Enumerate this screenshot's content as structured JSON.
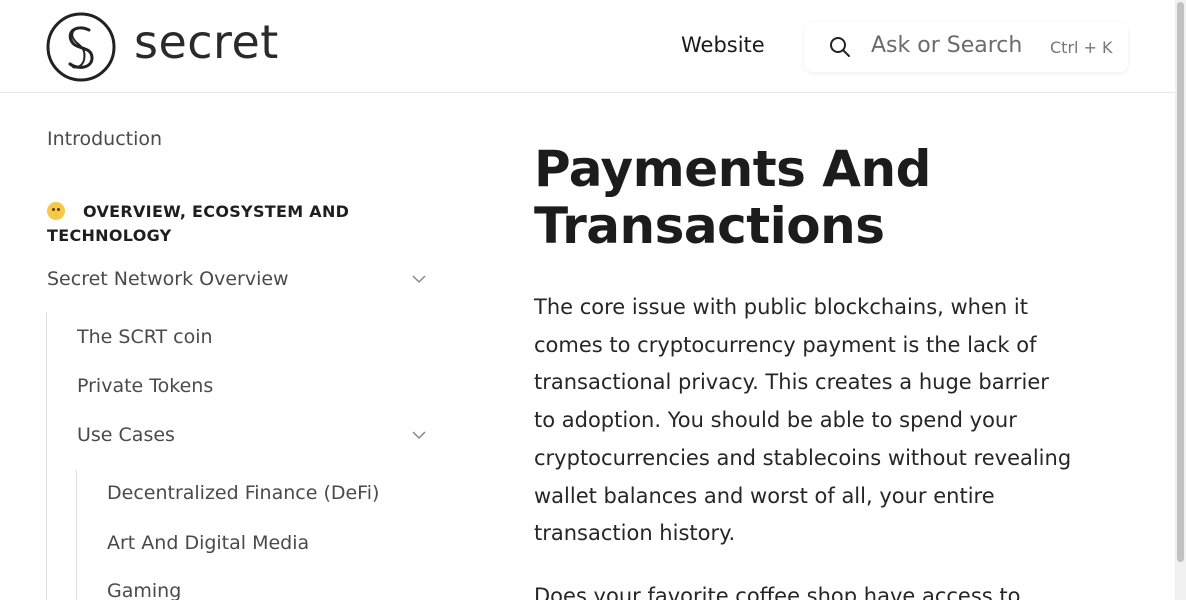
{
  "header": {
    "logo_text": "secret",
    "nav_link": "Website",
    "search": {
      "placeholder": "Ask or Search",
      "shortcut": "Ctrl + K"
    }
  },
  "sidebar": {
    "intro": "Introduction",
    "section_title": "OVERVIEW, ECOSYSTEM AND TECHNOLOGY",
    "section_icon": "shushing-face-emoji",
    "items": [
      {
        "label": "Secret Network Overview",
        "expandable": true
      },
      {
        "label": "The SCRT coin"
      },
      {
        "label": "Private Tokens"
      },
      {
        "label": "Use Cases",
        "expandable": true
      },
      {
        "label": "Decentralized Finance (DeFi)"
      },
      {
        "label": "Art And Digital Media"
      },
      {
        "label": "Gaming"
      }
    ]
  },
  "main": {
    "title": "Payments And Transactions",
    "paragraphs": [
      "The core issue with public blockchains, when it comes to cryptocurrency payment is the lack of transactional privacy. This creates a huge barrier to adoption. You should be able to spend your cryptocurrencies and stablecoins without revealing wallet balances and worst of all, your entire transaction history.",
      "Does your favorite coffee shop have access to"
    ]
  }
}
